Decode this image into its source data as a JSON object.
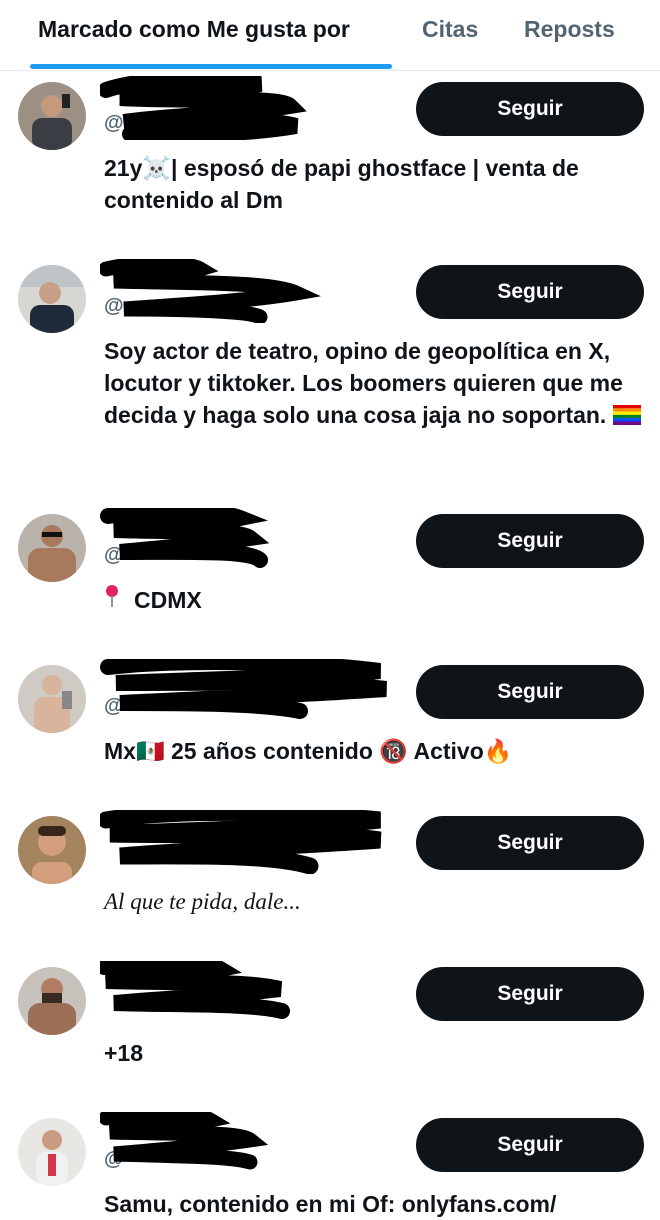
{
  "tabs": {
    "liked": "Marcado como Me gusta por",
    "quotes": "Citas",
    "reposts": "Reposts"
  },
  "users": [
    {
      "handle_hint": "@",
      "button": "Seguir",
      "bio": "21y☠️| esposó de papi ghostface | venta de contenido al Dm"
    },
    {
      "handle_hint": "@",
      "button": "Seguir",
      "bio": "Soy actor de teatro, opino de geopolítica en X, locutor y tiktoker. Los boomers quieren que me decida y haga solo una cosa jaja no soportan."
    },
    {
      "handle_hint": "@",
      "button": "Seguir",
      "bio": "CDMX"
    },
    {
      "handle_hint": "@",
      "button": "Seguir",
      "bio": "Mx🇲🇽 25 años contenido 🔞 Activo🔥"
    },
    {
      "handle_hint": "",
      "button": "Seguir",
      "bio": "Al que te pida, dale..."
    },
    {
      "handle_hint": "",
      "button": "Seguir",
      "bio": "+18"
    },
    {
      "handle_hint": "@",
      "button": "Seguir",
      "bio": "Samu, contenido en mi Of: onlyfans.com/"
    }
  ],
  "colors": {
    "text": "#0f1419",
    "muted": "#536471",
    "accent": "#1d9bf0",
    "button_bg": "#0f1419",
    "button_text": "#ffffff"
  }
}
